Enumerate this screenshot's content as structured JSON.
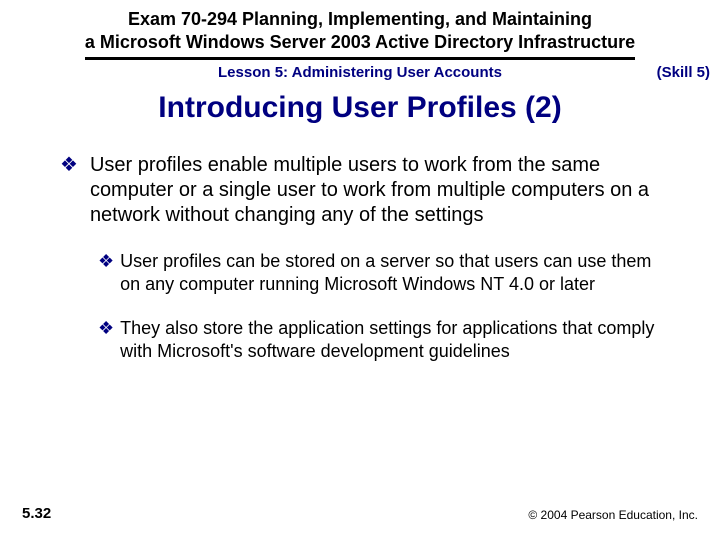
{
  "header": {
    "line1": "Exam 70-294 Planning, Implementing, and Maintaining",
    "line2": "a Microsoft Windows Server 2003 Active Directory Infrastructure"
  },
  "lesson": "Lesson 5: Administering User Accounts",
  "skill": "(Skill 5)",
  "title": "Introducing User Profiles (2)",
  "bullets": {
    "b1": "User profiles enable multiple users to work from the same computer or a single user to work from multiple computers on a network without changing any of the settings",
    "b1a": "User profiles can be stored on a server so that users can use them on any computer running Microsoft Windows NT 4.0 or later",
    "b1b": "They also store the application settings for applications that comply with Microsoft's software development guidelines"
  },
  "footer": {
    "page": "5.32",
    "copyright": "© 2004 Pearson Education, Inc."
  },
  "marker": "❖"
}
